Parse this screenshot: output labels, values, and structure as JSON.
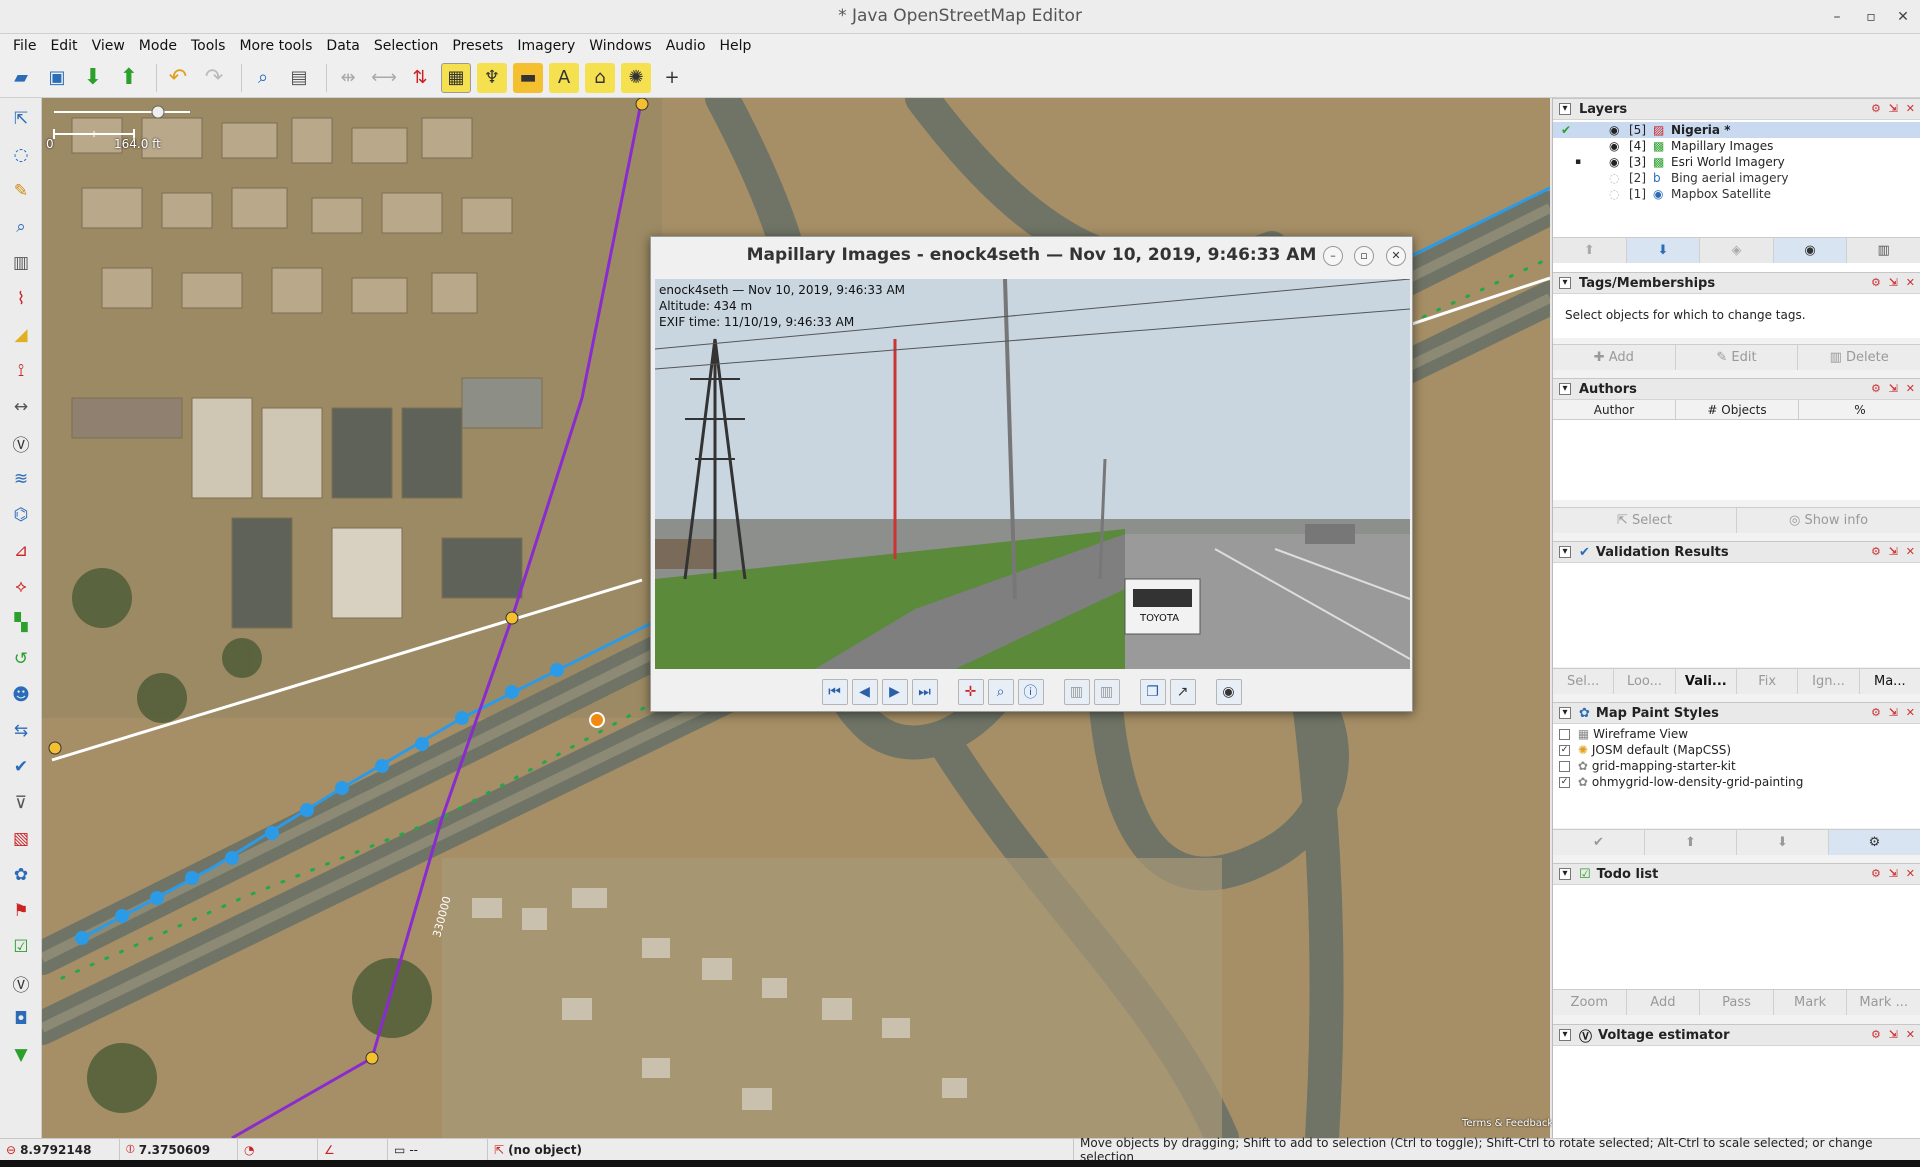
{
  "window": {
    "title": "* Java OpenStreetMap Editor"
  },
  "menu": {
    "items": [
      "File",
      "Edit",
      "View",
      "Mode",
      "Tools",
      "More tools",
      "Data",
      "Selection",
      "Presets",
      "Imagery",
      "Windows",
      "Audio",
      "Help"
    ]
  },
  "map": {
    "scale_label": "164.0 ft",
    "scale_zero": "0",
    "terms": "Terms & Feedback",
    "line_label": "330000"
  },
  "photo": {
    "title": "Mapillary Images - enock4seth — Nov 10, 2019, 9:46:33 AM",
    "info_line1": "enock4seth — Nov 10, 2019, 9:46:33 AM",
    "info_line2": "Altitude: 434 m",
    "info_line3": "EXIF time: 11/10/19, 9:46:33 AM",
    "truck_text": "TOYOTA"
  },
  "layers": {
    "title": "Layers",
    "items": [
      {
        "num": "[5]",
        "name": "Nigeria *"
      },
      {
        "num": "[4]",
        "name": "Mapillary Images"
      },
      {
        "num": "[3]",
        "name": "Esri World Imagery"
      },
      {
        "num": "[2]",
        "name": "Bing aerial imagery"
      },
      {
        "num": "[1]",
        "name": "Mapbox Satellite"
      }
    ]
  },
  "tags": {
    "title": "Tags/Memberships",
    "empty_text": "Select objects for which to change tags.",
    "add": "Add",
    "edit": "Edit",
    "delete": "Delete"
  },
  "authors": {
    "title": "Authors",
    "col_author": "Author",
    "col_objects": "# Objects",
    "col_percent": "%",
    "select": "Select",
    "show_info": "Show info"
  },
  "validation": {
    "title": "Validation Results",
    "buttons": [
      "Sel...",
      "Loo...",
      "Vali...",
      "Fix",
      "Ign...",
      "Ma..."
    ]
  },
  "paint_styles": {
    "title": "Map Paint Styles",
    "items": [
      {
        "name": "Wireframe View",
        "checked": ""
      },
      {
        "name": "JOSM default (MapCSS)",
        "checked": "✓"
      },
      {
        "name": "grid-mapping-starter-kit",
        "checked": ""
      },
      {
        "name": "ohmygrid-low-density-grid-painting",
        "checked": "✓"
      }
    ]
  },
  "todo": {
    "title": "Todo list",
    "buttons": [
      "Zoom",
      "Add",
      "Pass",
      "Mark",
      "Mark ..."
    ]
  },
  "voltage": {
    "title": "Voltage estimator"
  },
  "status": {
    "lat": "8.9792148",
    "lon": "7.3750609",
    "heading": "--",
    "selection": "(no object)",
    "help": "Move objects by dragging; Shift to add to selection (Ctrl to toggle); Shift-Ctrl to rotate selected; Alt-Ctrl to scale selected; or change selection"
  },
  "colors": {
    "powerline": "#8a2bd0",
    "road_blue": "#2b9be8",
    "road_green": "#22a84a",
    "accent": "#2b5fa8"
  }
}
